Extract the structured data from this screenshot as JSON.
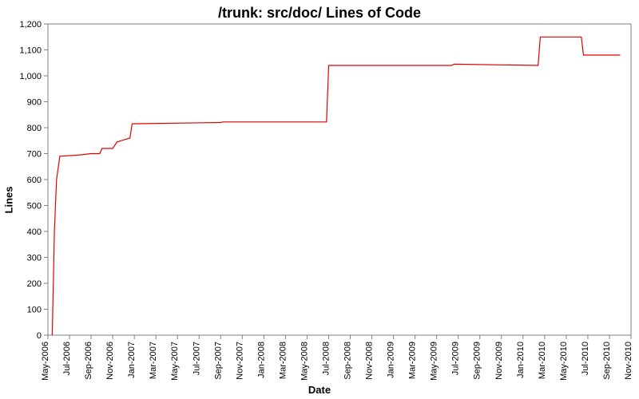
{
  "chart_data": {
    "type": "line",
    "title": "/trunk: src/doc/ Lines of Code",
    "xlabel": "Date",
    "ylabel": "Lines",
    "ylim": [
      0,
      1200
    ],
    "y_ticks": [
      0,
      100,
      200,
      300,
      400,
      500,
      600,
      700,
      800,
      900,
      1000,
      1100,
      1200
    ],
    "y_tick_labels": [
      "0",
      "100",
      "200",
      "300",
      "400",
      "500",
      "600",
      "700",
      "800",
      "900",
      "1,000",
      "1,100",
      "1,200"
    ],
    "x_ticks_idx": [
      0,
      1,
      2,
      3,
      4,
      5,
      6,
      7,
      8,
      9,
      10,
      11,
      12,
      13,
      14,
      15,
      16,
      17,
      18,
      19,
      20,
      21,
      22,
      23,
      24,
      25,
      26,
      27
    ],
    "x_tick_labels": [
      "May-2006",
      "Jul-2006",
      "Sep-2006",
      "Nov-2006",
      "Jan-2007",
      "Mar-2007",
      "May-2007",
      "Jul-2007",
      "Sep-2007",
      "Nov-2007",
      "Jan-2008",
      "Mar-2008",
      "May-2008",
      "Jul-2008",
      "Sep-2008",
      "Nov-2008",
      "Jan-2009",
      "Mar-2009",
      "May-2009",
      "Jul-2009",
      "Sep-2009",
      "Nov-2009",
      "Jan-2010",
      "Mar-2010",
      "May-2010",
      "Jul-2010",
      "Sep-2010",
      "Nov-2010"
    ],
    "series": [
      {
        "name": "Lines of Code",
        "color": "#e00000",
        "points": [
          {
            "x_idx": 0.2,
            "y": 0
          },
          {
            "x_idx": 0.3,
            "y": 400
          },
          {
            "x_idx": 0.4,
            "y": 600
          },
          {
            "x_idx": 0.55,
            "y": 690
          },
          {
            "x_idx": 1.5,
            "y": 695
          },
          {
            "x_idx": 2.0,
            "y": 700
          },
          {
            "x_idx": 2.4,
            "y": 700
          },
          {
            "x_idx": 2.5,
            "y": 720
          },
          {
            "x_idx": 3.0,
            "y": 720
          },
          {
            "x_idx": 3.2,
            "y": 745
          },
          {
            "x_idx": 3.6,
            "y": 755
          },
          {
            "x_idx": 3.8,
            "y": 760
          },
          {
            "x_idx": 3.9,
            "y": 815
          },
          {
            "x_idx": 8.0,
            "y": 820
          },
          {
            "x_idx": 8.1,
            "y": 822
          },
          {
            "x_idx": 12.9,
            "y": 822
          },
          {
            "x_idx": 13.0,
            "y": 1040
          },
          {
            "x_idx": 18.7,
            "y": 1040
          },
          {
            "x_idx": 18.8,
            "y": 1045
          },
          {
            "x_idx": 22.7,
            "y": 1040
          },
          {
            "x_idx": 22.8,
            "y": 1150
          },
          {
            "x_idx": 24.7,
            "y": 1150
          },
          {
            "x_idx": 24.8,
            "y": 1080
          },
          {
            "x_idx": 26.5,
            "y": 1080
          }
        ]
      }
    ]
  }
}
